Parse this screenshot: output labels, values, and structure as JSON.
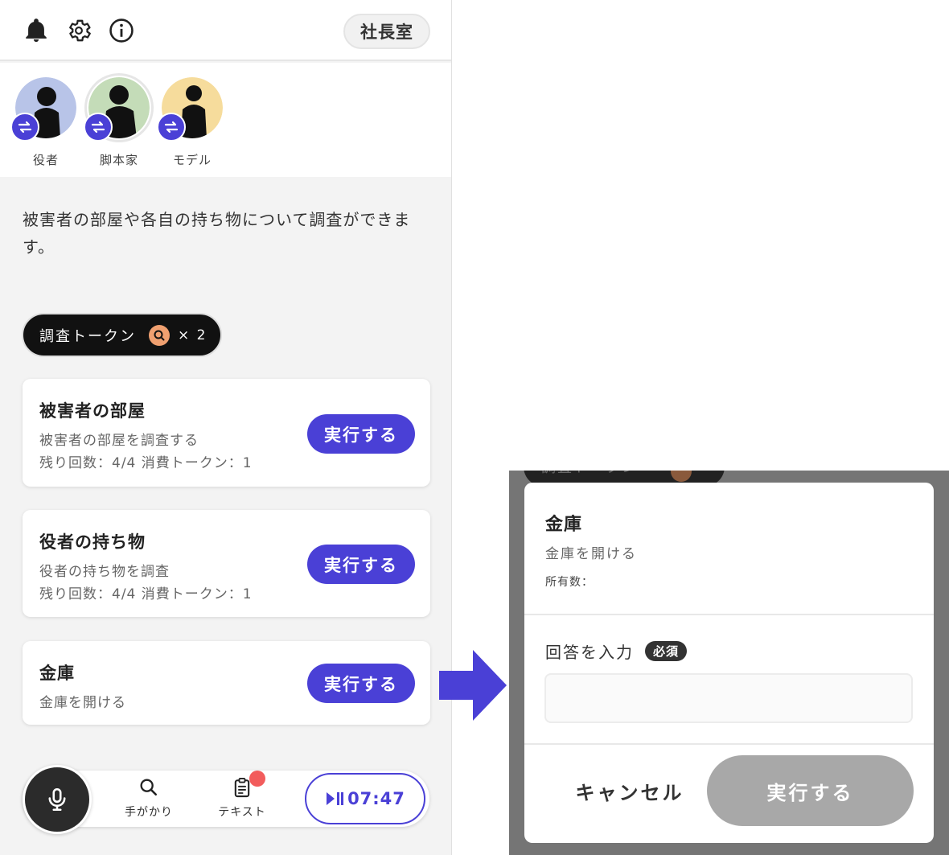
{
  "header": {
    "room_label": "社長室",
    "icons": [
      "bell-icon",
      "gear-icon",
      "info-icon"
    ]
  },
  "characters": [
    {
      "name": "役者",
      "avatar_color": "#b8c4e8",
      "selected": false
    },
    {
      "name": "脚本家",
      "avatar_color": "#c4dcb8",
      "selected": true
    },
    {
      "name": "モデル",
      "avatar_color": "#f6dc9c",
      "selected": false
    }
  ],
  "intro_text": "被害者の部屋や各自の持ち物について調査ができます。",
  "token": {
    "label": "調査トークン",
    "count": "× 2"
  },
  "cards": [
    {
      "title": "被害者の部屋",
      "description": "被害者の部屋を調査する",
      "meta": "残り回数：4/4 消費トークン：1",
      "button": "実行する"
    },
    {
      "title": "役者の持ち物",
      "description": "役者の持ち物を調査",
      "meta": "残り回数：4/4 消費トークン：1",
      "button": "実行する"
    },
    {
      "title": "金庫",
      "description": "金庫を開ける",
      "button": "実行する"
    }
  ],
  "nav": {
    "clues_label": "手がかり",
    "text_label": "テキスト",
    "timer": "07:47"
  },
  "modal": {
    "background_pill": "調査トークン",
    "title": "金庫",
    "description": "金庫を開ける",
    "owned_label": "所有数：",
    "answer_label": "回答を入力",
    "required_badge": "必須",
    "answer_value": "",
    "cancel_label": "キャンセル",
    "exec_label": "実行する"
  },
  "colors": {
    "accent": "#4a40d6",
    "notification": "#f25c5c",
    "disabled": "#a8a8a8"
  }
}
